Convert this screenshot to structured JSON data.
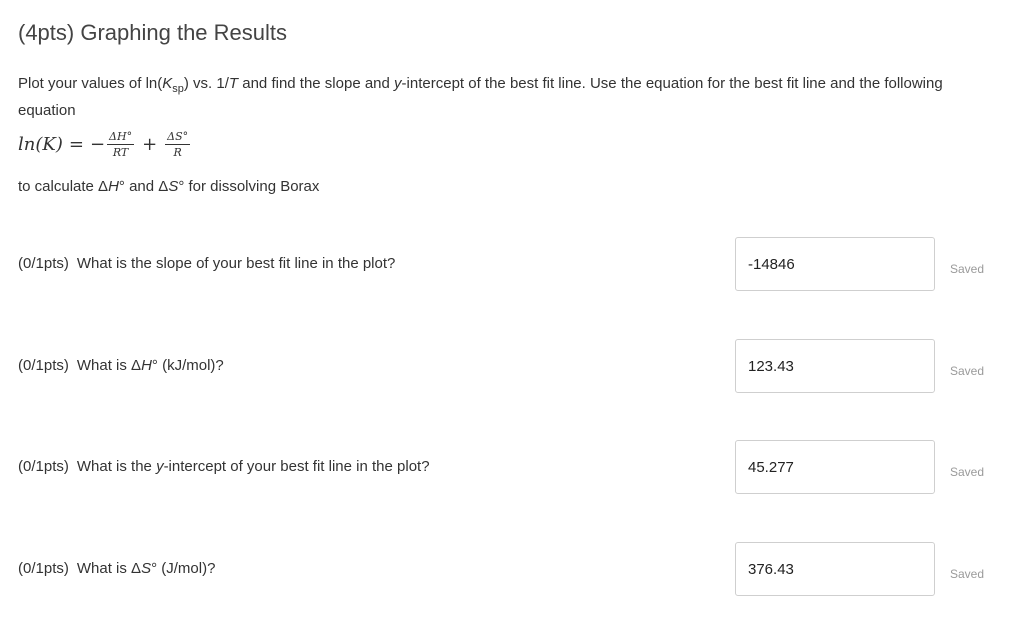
{
  "section": {
    "title": "(4pts) Graphing the Results"
  },
  "intro": {
    "part1": "Plot your values of ln(",
    "k": "K",
    "sp": "sp",
    "part2": ") vs. 1/",
    "t": "T",
    "part3": " and find the slope and ",
    "y": "y",
    "part4": "-intercept of the best fit line. Use the equation for the best fit line and the following equation"
  },
  "equation": {
    "lhs": "ln(K)",
    "eq": "=",
    "minus": "−",
    "frac1_num": "ΔH°",
    "frac1_den": "RT",
    "plus": "+",
    "frac2_num": "ΔS°",
    "frac2_den": "R"
  },
  "calc_line": {
    "part1": "to calculate Δ",
    "h": "H",
    "part2": "° and Δ",
    "s": "S",
    "part3": "° for dissolving Borax"
  },
  "questions": [
    {
      "points": "(0/1pts)",
      "text_before": "What is the slope of your best fit line in the plot?",
      "text_italic": "",
      "text_after": "",
      "answer": "-14846",
      "status": "Saved"
    },
    {
      "points": "(0/1pts)",
      "text_before": "What is Δ",
      "text_italic": "H",
      "text_after": "° (kJ/mol)?",
      "answer": "123.43",
      "status": "Saved"
    },
    {
      "points": "(0/1pts)",
      "text_before": "What is the ",
      "text_italic": "y",
      "text_after": "-intercept of your best fit line in the plot?",
      "answer": "45.277",
      "status": "Saved"
    },
    {
      "points": "(0/1pts)",
      "text_before": "What is Δ",
      "text_italic": "S",
      "text_after": "° (J/mol)?",
      "answer": "376.43",
      "status": "Saved"
    }
  ]
}
